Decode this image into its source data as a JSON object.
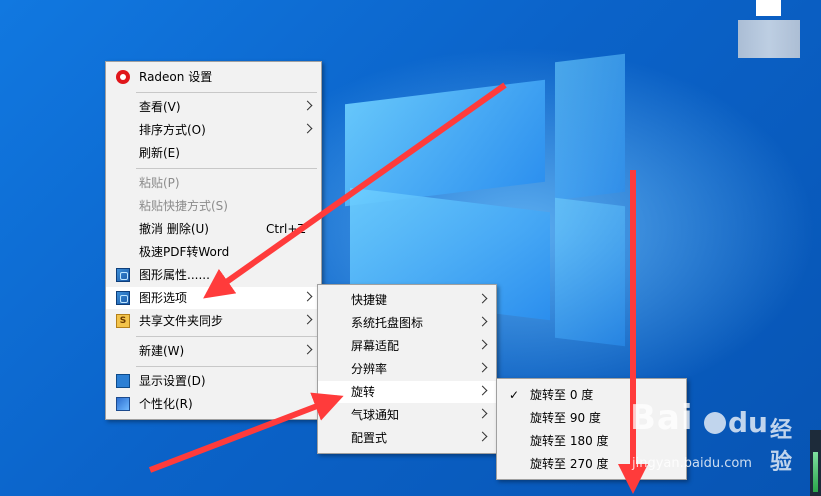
{
  "main_menu": {
    "items": [
      {
        "label": "Radeon 设置",
        "icon": "radeon-icon"
      },
      {
        "label": "查看(V)",
        "submenu": true
      },
      {
        "label": "排序方式(O)",
        "submenu": true
      },
      {
        "label": "刷新(E)"
      },
      {
        "label": "粘贴(P)",
        "disabled": true
      },
      {
        "label": "粘贴快捷方式(S)",
        "disabled": true
      },
      {
        "label": "撤消 删除(U)",
        "shortcut": "Ctrl+Z"
      },
      {
        "label": "极速PDF转Word"
      },
      {
        "label": "图形属性......",
        "icon": "intel-graphics-icon"
      },
      {
        "label": "图形选项",
        "icon": "intel-graphics-icon",
        "submenu": true,
        "highlighted": true
      },
      {
        "label": "共享文件夹同步",
        "icon": "share-folder-icon",
        "submenu": true
      },
      {
        "label": "新建(W)",
        "submenu": true
      },
      {
        "label": "显示设置(D)",
        "icon": "display-icon"
      },
      {
        "label": "个性化(R)",
        "icon": "personalize-icon"
      }
    ]
  },
  "graphics_menu": {
    "items": [
      {
        "label": "快捷键",
        "submenu": true
      },
      {
        "label": "系统托盘图标",
        "submenu": true
      },
      {
        "label": "屏幕适配",
        "submenu": true
      },
      {
        "label": "分辨率",
        "submenu": true
      },
      {
        "label": "旋转",
        "submenu": true,
        "highlighted": true
      },
      {
        "label": "气球通知",
        "submenu": true
      },
      {
        "label": "配置式",
        "submenu": true
      }
    ]
  },
  "rotate_menu": {
    "items": [
      {
        "label": "旋转至 0 度",
        "checked": true
      },
      {
        "label": "旋转至 90 度"
      },
      {
        "label": "旋转至 180 度"
      },
      {
        "label": "旋转至 270 度"
      }
    ]
  },
  "watermark": {
    "logo": "Bai",
    "logo_suffix": "du",
    "cn": "经验",
    "url": "jingyan.baidu.com"
  },
  "colors": {
    "annotation_arrow": "#ff3b3b",
    "menu_bg": "#f2f2f2",
    "highlight_bg": "#ffffff"
  }
}
